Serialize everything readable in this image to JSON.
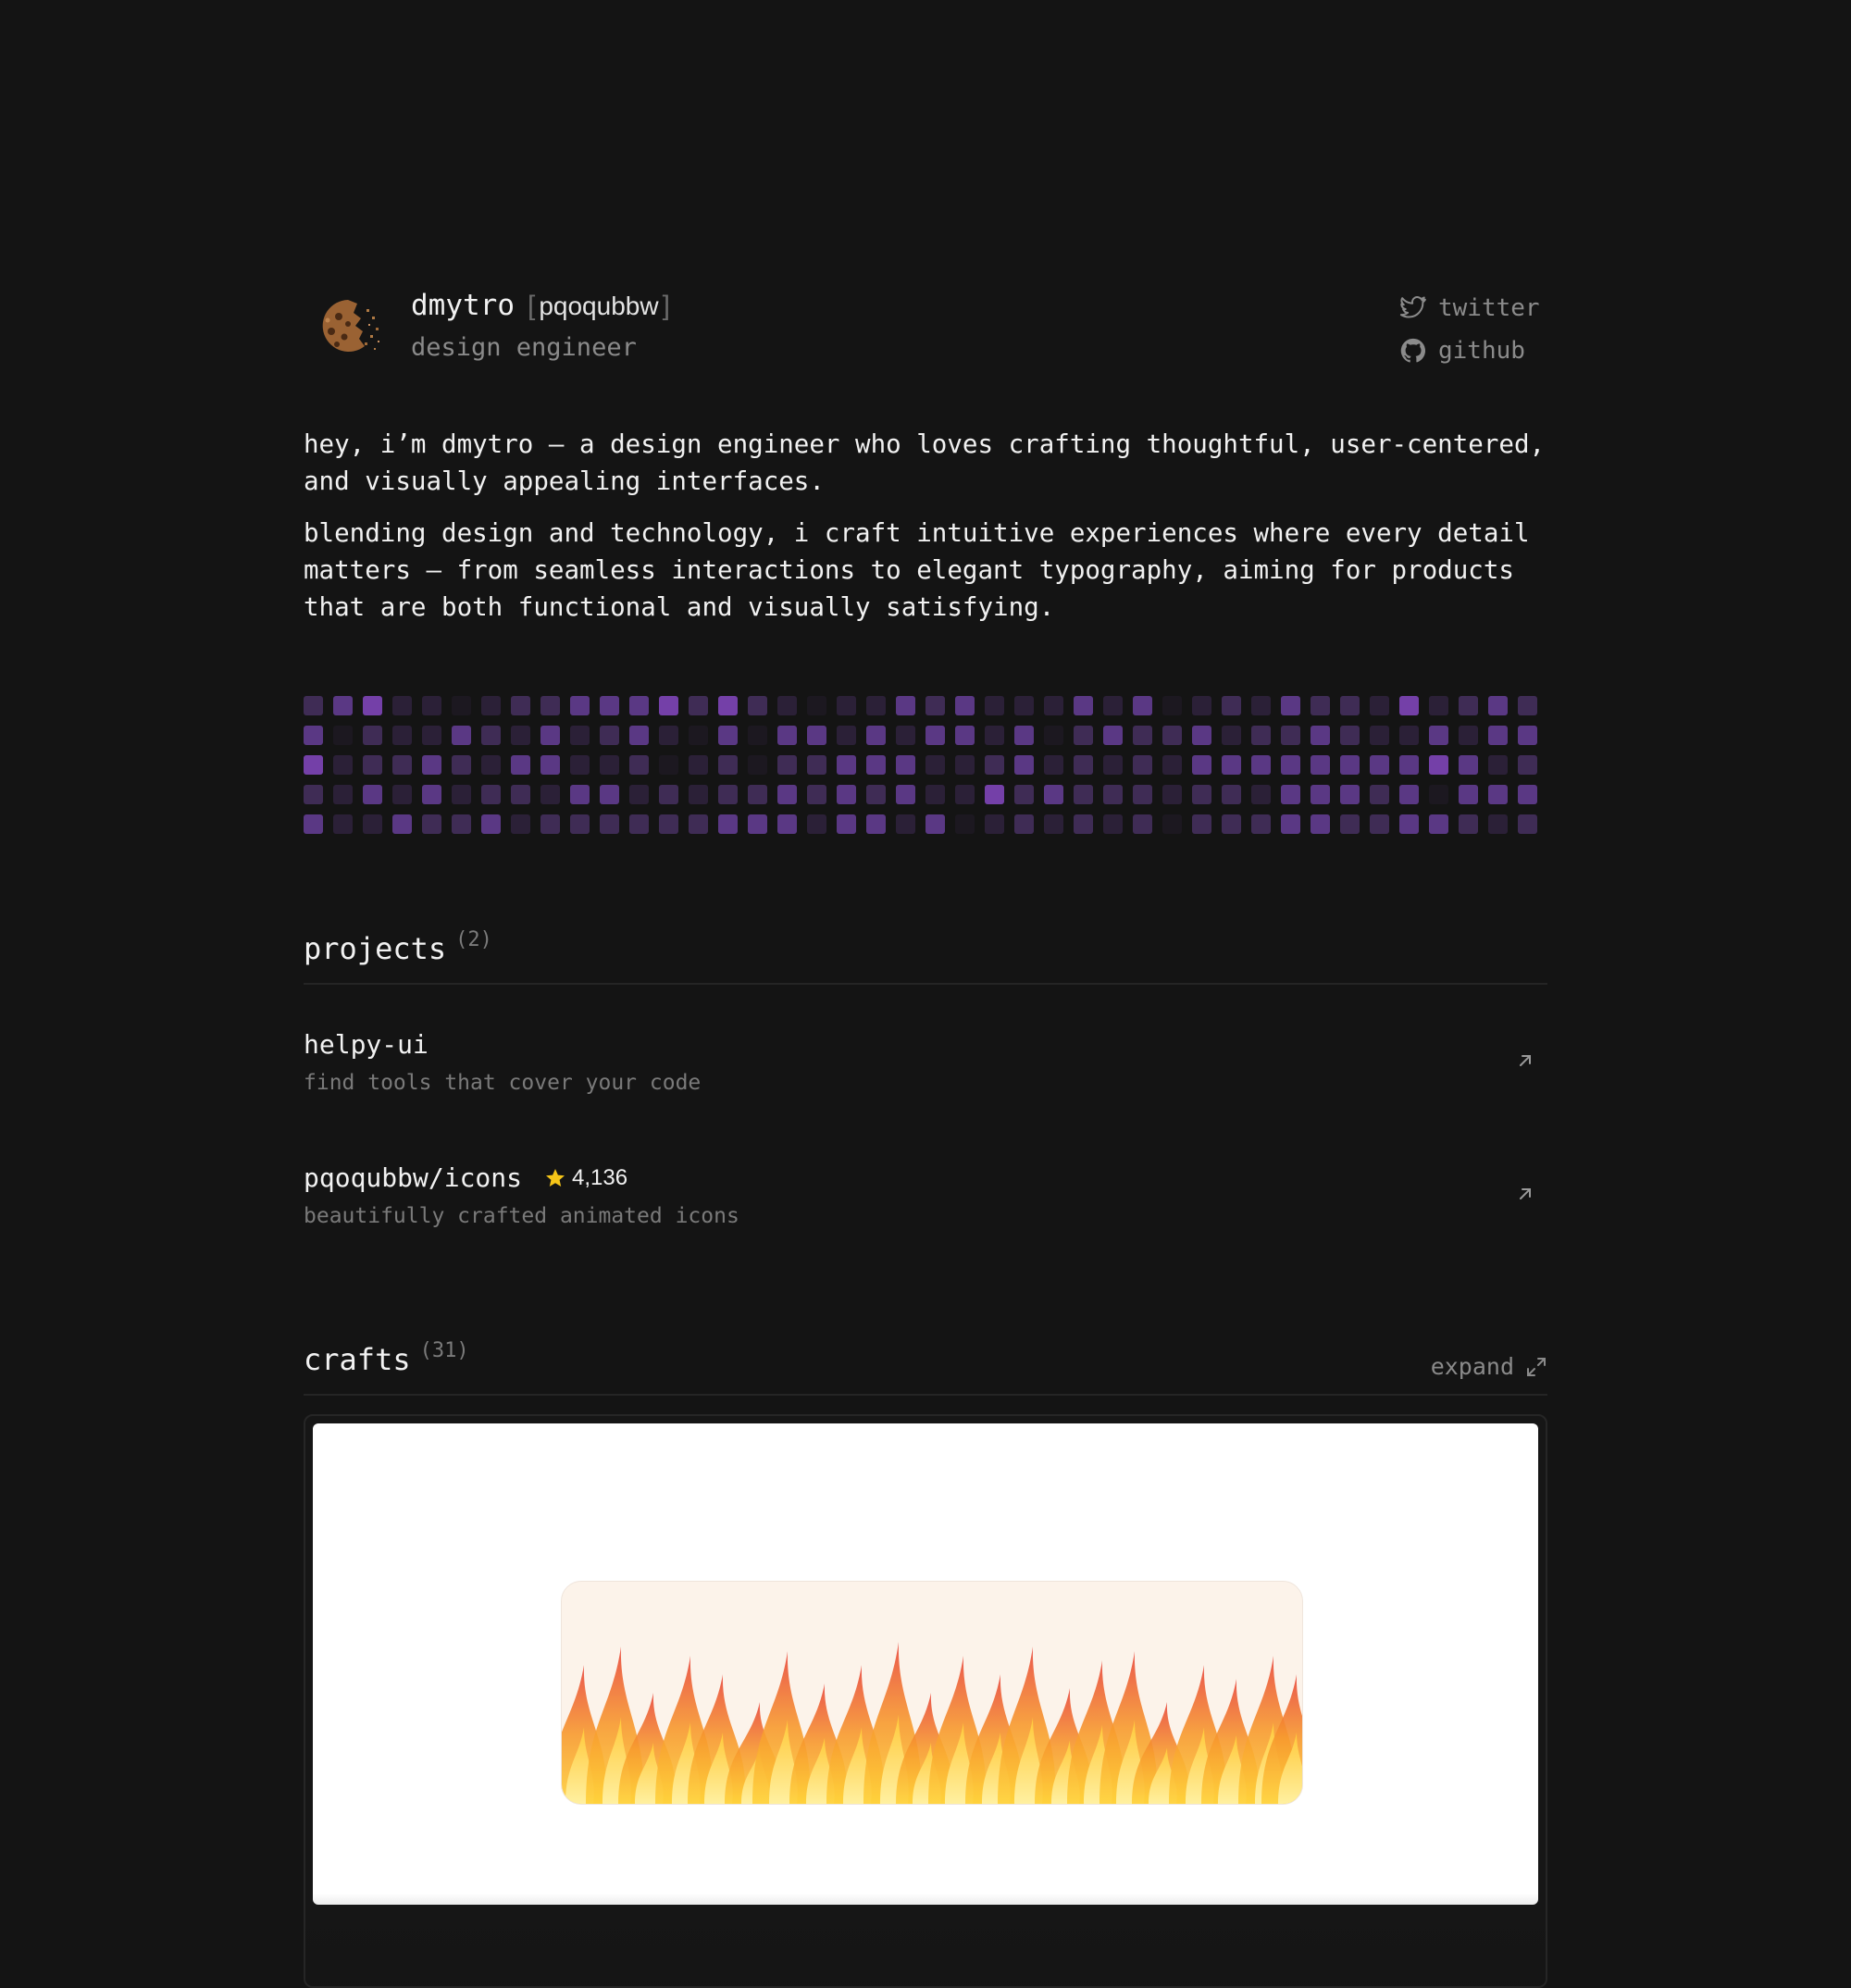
{
  "profile": {
    "name": "dmytro",
    "handle_open": "[",
    "handle": "pqoqubbw",
    "handle_close": "]",
    "role": "design engineer"
  },
  "socials": [
    {
      "label": "twitter",
      "icon": "twitter-icon"
    },
    {
      "label": "github",
      "icon": "github-icon"
    }
  ],
  "bio": [
    "hey, i’m dmytro — a design engineer who loves crafting thoughtful, user-centered, and visually appealing interfaces.",
    "blending design and technology, i craft intuitive experiences where every detail matters — from seamless interactions to elegant typography, aiming for products that are both functional and visually satisfying."
  ],
  "activity": {
    "colors": [
      "#1c1820",
      "#2b2037",
      "#3f2c55",
      "#5a3884",
      "#7440a8"
    ],
    "rows": [
      [
        2,
        3,
        4,
        1,
        1,
        0,
        1,
        2,
        2,
        3,
        3,
        3,
        4,
        2,
        4,
        2,
        1,
        0,
        1,
        1,
        3,
        2,
        3,
        1,
        1,
        1,
        3,
        1,
        3,
        0,
        1,
        2,
        1,
        3,
        2,
        2,
        1,
        4,
        1,
        2,
        3,
        2
      ],
      [
        3,
        0,
        2,
        1,
        1,
        3,
        2,
        1,
        3,
        1,
        2,
        3,
        1,
        0,
        3,
        0,
        3,
        3,
        1,
        3,
        1,
        3,
        3,
        1,
        3,
        0,
        2,
        3,
        2,
        2,
        3,
        1,
        2,
        2,
        3,
        2,
        1,
        1,
        3,
        1,
        3,
        3
      ],
      [
        4,
        1,
        2,
        2,
        3,
        2,
        1,
        3,
        3,
        1,
        1,
        2,
        0,
        1,
        2,
        0,
        2,
        2,
        3,
        3,
        3,
        1,
        1,
        2,
        3,
        1,
        2,
        1,
        2,
        1,
        3,
        3,
        3,
        3,
        3,
        3,
        3,
        3,
        4,
        3,
        1,
        2
      ],
      [
        2,
        1,
        3,
        1,
        3,
        1,
        2,
        2,
        1,
        3,
        3,
        1,
        2,
        1,
        2,
        2,
        3,
        2,
        3,
        2,
        3,
        1,
        1,
        4,
        2,
        3,
        2,
        2,
        2,
        1,
        2,
        2,
        1,
        3,
        3,
        3,
        2,
        3,
        0,
        3,
        3,
        3
      ],
      [
        3,
        1,
        1,
        3,
        2,
        2,
        3,
        1,
        2,
        2,
        2,
        2,
        2,
        2,
        3,
        3,
        3,
        1,
        3,
        3,
        1,
        3,
        0,
        1,
        2,
        1,
        2,
        1,
        2,
        0,
        2,
        2,
        2,
        3,
        3,
        2,
        2,
        3,
        3,
        2,
        1,
        2
      ]
    ]
  },
  "projects": {
    "title": "projects",
    "count": "(2)",
    "items": [
      {
        "name": "helpy-ui",
        "desc": "find tools that cover your code",
        "stars": ""
      },
      {
        "name": "pqoqubbw/icons",
        "desc": "beautifully crafted animated icons",
        "stars": "4,136"
      }
    ]
  },
  "crafts": {
    "title": "crafts",
    "count": "(31)",
    "expand_label": "expand"
  },
  "colors": {
    "background": "#141414",
    "accent": "#7440a8",
    "star": "#f5c518"
  }
}
